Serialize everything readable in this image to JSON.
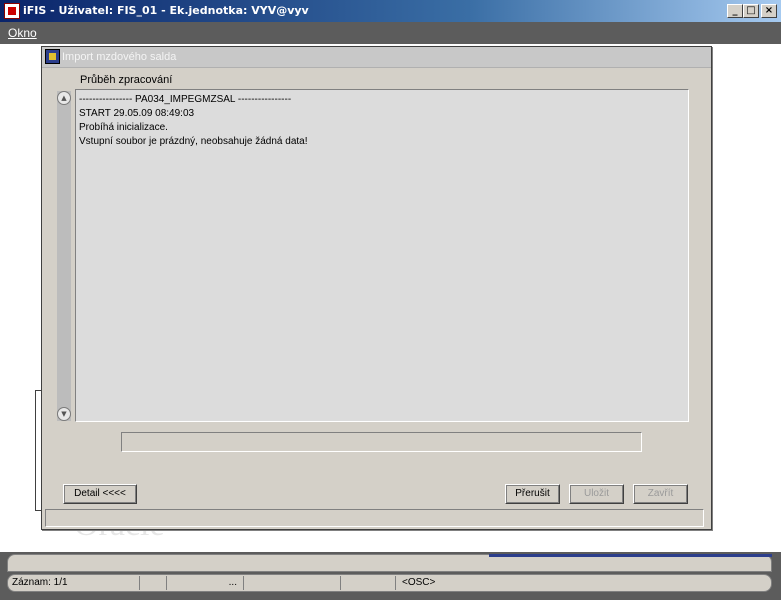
{
  "window": {
    "title": "iFIS - Uživatel: FIS_01 - Ek.jednotka: VYV@vyv",
    "minimize_label": "_",
    "maximize_label": "□",
    "close_label": "×"
  },
  "menu": {
    "items": [
      {
        "label": "Okno"
      }
    ]
  },
  "background": {
    "watermark": "Oracle"
  },
  "dialog": {
    "title": "Import mzdového salda",
    "section_label": "Průběh zpracování",
    "log_lines": [
      "---------------- PA034_IMPEGMZSAL ----------------",
      "START 29.05.09 08:49:03",
      "Probíhá inicializace.",
      "Vstupní soubor je prázdný, neobsahuje žádná data!"
    ],
    "progress": 0,
    "buttons": {
      "detail": "Detail  <<<<",
      "interrupt": "Přerušit",
      "save": "Uložit",
      "close": "Zavřít"
    }
  },
  "statusbar": {
    "record": "Záznam: 1/1",
    "ellipsis": "...",
    "mode": "<OSC>"
  }
}
